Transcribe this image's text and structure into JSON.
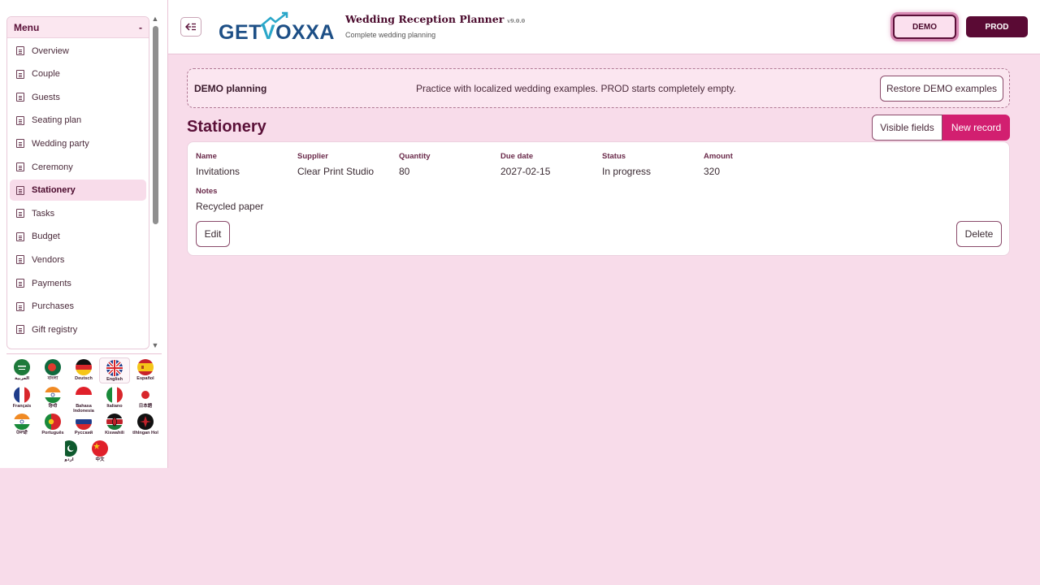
{
  "sidebar": {
    "menu_title": "Menu",
    "collapse_symbol": "-",
    "items": [
      {
        "label": "Overview",
        "active": false
      },
      {
        "label": "Couple",
        "active": false
      },
      {
        "label": "Guests",
        "active": false
      },
      {
        "label": "Seating plan",
        "active": false
      },
      {
        "label": "Wedding party",
        "active": false
      },
      {
        "label": "Ceremony",
        "active": false
      },
      {
        "label": "Stationery",
        "active": true
      },
      {
        "label": "Tasks",
        "active": false
      },
      {
        "label": "Budget",
        "active": false
      },
      {
        "label": "Vendors",
        "active": false
      },
      {
        "label": "Payments",
        "active": false
      },
      {
        "label": "Purchases",
        "active": false
      },
      {
        "label": "Gift registry",
        "active": false
      }
    ],
    "languages": [
      {
        "label": "العربية",
        "icon": "saudi-flag-icon"
      },
      {
        "label": "বাংলা",
        "icon": "bangladesh-flag-icon"
      },
      {
        "label": "Deutsch",
        "icon": "germany-flag-icon"
      },
      {
        "label": "English",
        "icon": "uk-flag-icon",
        "active": true
      },
      {
        "label": "Español",
        "icon": "spain-flag-icon"
      },
      {
        "label": "Français",
        "icon": "france-flag-icon"
      },
      {
        "label": "हिन्दी",
        "icon": "india-flag-icon"
      },
      {
        "label": "Bahasa Indonesia",
        "icon": "indonesia-flag-icon"
      },
      {
        "label": "Italiano",
        "icon": "italy-flag-icon"
      },
      {
        "label": "日本語",
        "icon": "japan-flag-icon"
      },
      {
        "label": "ਪੰਜਾਬੀ",
        "icon": "india-flag-icon"
      },
      {
        "label": "Português",
        "icon": "portugal-flag-icon"
      },
      {
        "label": "Русский",
        "icon": "russia-flag-icon"
      },
      {
        "label": "Kiswahili",
        "icon": "kenya-flag-icon"
      },
      {
        "label": "tlhIngan Hol",
        "icon": "klingon-flag-icon"
      },
      {
        "label": "اردو",
        "icon": "pakistan-flag-icon"
      },
      {
        "label": "中文",
        "icon": "china-flag-icon"
      }
    ]
  },
  "header": {
    "logo_part1": "GET",
    "logo_part2": "V",
    "logo_part3": "OXXA",
    "title": "Wedding Reception Planner",
    "version": "v9.0.0",
    "subtitle": "Complete wedding planning",
    "demo_label": "DEMO",
    "prod_label": "PROD"
  },
  "banner": {
    "title": "DEMO planning",
    "text": "Practice with localized wedding examples. PROD starts completely empty.",
    "restore_label": "Restore DEMO examples"
  },
  "page": {
    "title": "Stationery",
    "visible_fields_label": "Visible fields",
    "new_record_label": "New record"
  },
  "record": {
    "fields": [
      {
        "label": "Name",
        "value": "Invitations"
      },
      {
        "label": "Supplier",
        "value": "Clear Print Studio"
      },
      {
        "label": "Quantity",
        "value": "80"
      },
      {
        "label": "Due date",
        "value": "2027-02-15"
      },
      {
        "label": "Status",
        "value": "In progress"
      },
      {
        "label": "Amount",
        "value": "320"
      }
    ],
    "notes_label": "Notes",
    "notes_value": "Recycled paper",
    "edit_label": "Edit",
    "delete_label": "Delete"
  },
  "colors": {
    "background": "#f8dcea",
    "accent": "#d21f70",
    "brand_dark": "#5a0a34"
  }
}
